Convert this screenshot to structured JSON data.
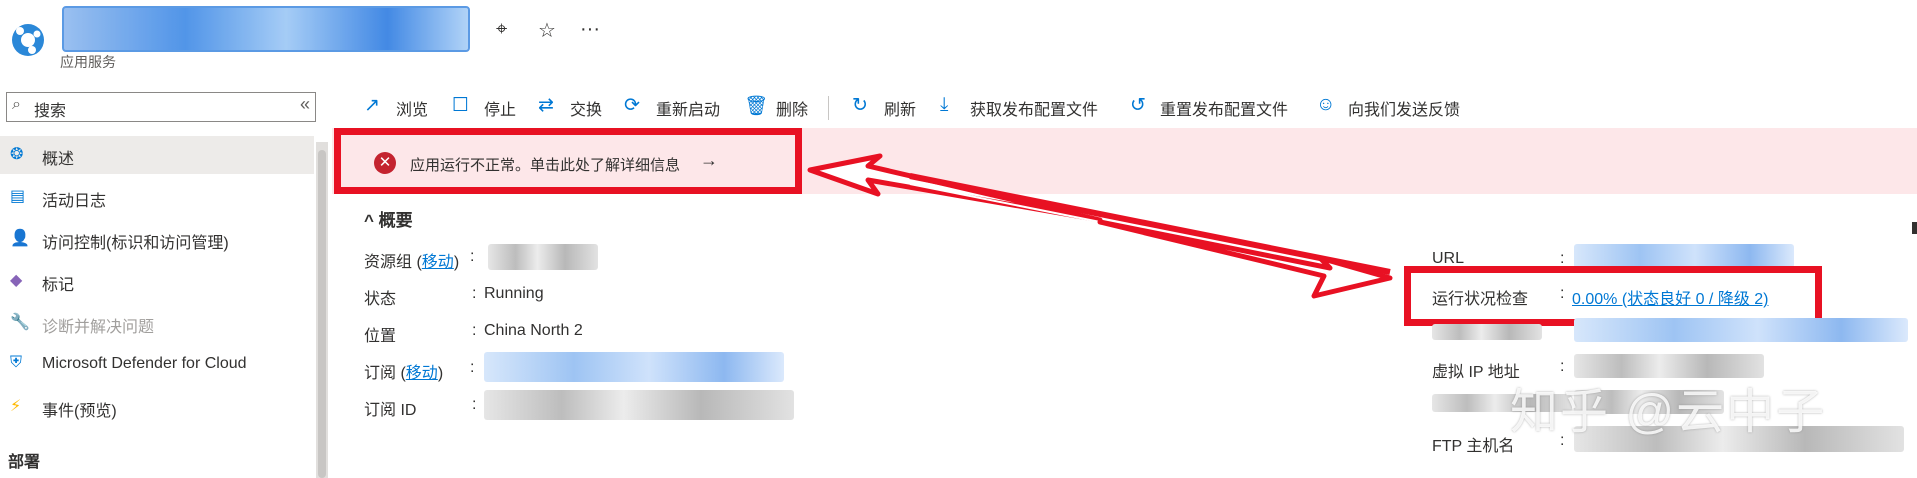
{
  "header": {
    "subtitle": "应用服务",
    "icons": [
      "app-service-icon",
      "pin-icon",
      "star-icon",
      "more-icon"
    ],
    "more_glyph": "···"
  },
  "sidebar": {
    "search_placeholder": "搜索",
    "collapse_glyph": "«",
    "items": [
      {
        "label": "概述",
        "icon": "overview-icon",
        "active": true
      },
      {
        "label": "活动日志",
        "icon": "activity-log-icon"
      },
      {
        "label": "访问控制(标识和访问管理)",
        "icon": "access-control-icon"
      },
      {
        "label": "标记",
        "icon": "tag-icon"
      },
      {
        "label": "诊断并解决问题",
        "icon": "wrench-icon",
        "dim": true
      },
      {
        "label": "Microsoft Defender for Cloud",
        "icon": "shield-icon"
      },
      {
        "label": "事件(预览)",
        "icon": "lightning-icon"
      }
    ],
    "section": "部署"
  },
  "toolbar": {
    "items": [
      {
        "label": "浏览",
        "icon": "open-external-icon"
      },
      {
        "label": "停止",
        "icon": "stop-icon"
      },
      {
        "label": "交换",
        "icon": "swap-icon"
      },
      {
        "label": "重新启动",
        "icon": "restart-icon"
      },
      {
        "label": "删除",
        "icon": "delete-icon"
      },
      {
        "label": "刷新",
        "icon": "refresh-icon"
      },
      {
        "label": "获取发布配置文件",
        "icon": "download-icon"
      },
      {
        "label": "重置发布配置文件",
        "icon": "undo-icon"
      },
      {
        "label": "向我们发送反馈",
        "icon": "feedback-icon"
      }
    ]
  },
  "alert": {
    "text": "应用运行不正常。单击此处了解详细信息",
    "arrow": "→",
    "icon": "error-icon"
  },
  "essentials": {
    "title": "概要",
    "toggle_glyph": "^",
    "left": [
      {
        "label": "资源组",
        "link": "移动",
        "sep": ":",
        "value": ""
      },
      {
        "label": "状态",
        "sep": ": ",
        "value": "Running"
      },
      {
        "label": "位置",
        "sep": ": ",
        "value": "China North 2"
      },
      {
        "label": "订阅",
        "link": "移动",
        "sep": ":",
        "value": ""
      },
      {
        "label": "订阅 ID",
        "sep": ":",
        "value": ""
      }
    ],
    "right": [
      {
        "label": "URL",
        "sep": ":"
      },
      {
        "label": "运行状况检查",
        "sep": ":",
        "value": "0.00% (状态良好 0 / 降级 2)"
      },
      {
        "label": "虚拟 IP 地址",
        "sep": ":"
      },
      {
        "label": "FTP 主机名",
        "sep": ":"
      }
    ]
  },
  "watermark": "知乎 @云中子",
  "colors": {
    "accent": "#0078d4",
    "annotation": "#e81123",
    "alert_bg": "#fde7e9"
  }
}
